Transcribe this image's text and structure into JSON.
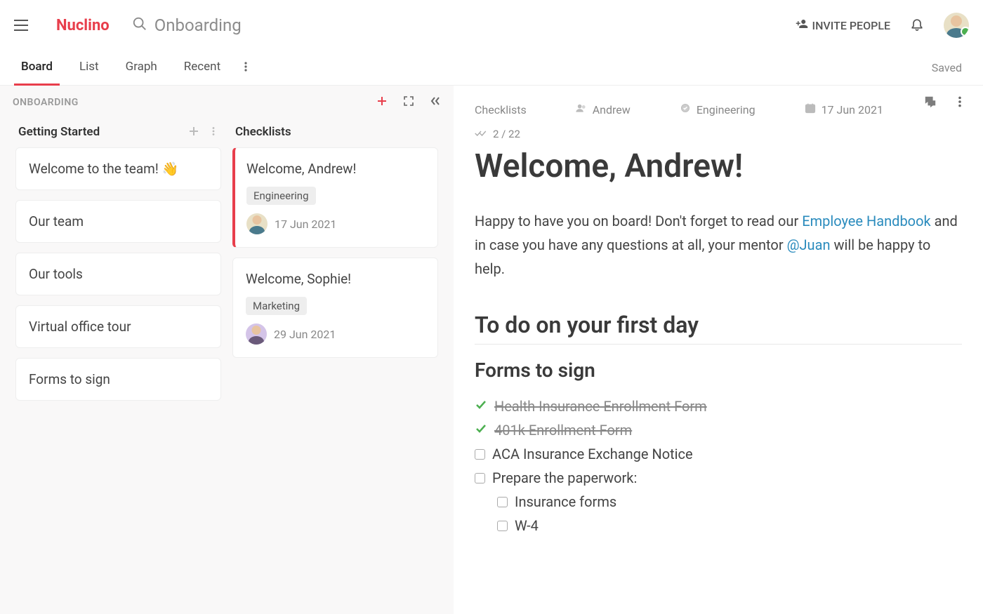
{
  "header": {
    "brand": "Nuclino",
    "search_text": "Onboarding",
    "invite_label": "INVITE PEOPLE",
    "saved_label": "Saved"
  },
  "tabs": {
    "items": [
      "Board",
      "List",
      "Graph",
      "Recent"
    ],
    "active_index": 0
  },
  "board": {
    "title": "ONBOARDING",
    "columns": [
      {
        "title": "Getting Started",
        "cards": [
          {
            "title": "Welcome to the team!",
            "emoji": "👋"
          },
          {
            "title": "Our team"
          },
          {
            "title": "Our tools"
          },
          {
            "title": "Virtual office tour"
          },
          {
            "title": "Forms to sign"
          }
        ]
      },
      {
        "title": "Checklists",
        "cards": [
          {
            "title": "Welcome, Andrew!",
            "tag": "Engineering",
            "date": "17 Jun 2021",
            "avatar": "andrew",
            "selected": true
          },
          {
            "title": "Welcome, Sophie!",
            "tag": "Marketing",
            "date": "29 Jun 2021",
            "avatar": "sophie"
          }
        ]
      }
    ]
  },
  "doc": {
    "breadcrumb": "Checklists",
    "assignee": "Andrew",
    "category": "Engineering",
    "date": "17 Jun 2021",
    "progress": "2 / 22",
    "title": "Welcome, Andrew!",
    "intro_pre": "Happy to have you on board! Don't forget to read our ",
    "link1": "Employee Handbook",
    "intro_mid": " and in case you have any questions at all, your mentor ",
    "link2": "@Juan",
    "intro_post": " will be happy to help.",
    "h2": "To do on your first day",
    "h3": "Forms to sign",
    "items": [
      {
        "text": "Health Insurance Enrollment Form",
        "done": true
      },
      {
        "text": "401k Enrollment Form",
        "done": true
      },
      {
        "text": "ACA Insurance Exchange Notice",
        "done": false
      },
      {
        "text": "Prepare the paperwork:",
        "done": false
      },
      {
        "text": "Insurance forms",
        "done": false,
        "sub": true
      },
      {
        "text": "W-4",
        "done": false,
        "sub": true
      }
    ]
  }
}
